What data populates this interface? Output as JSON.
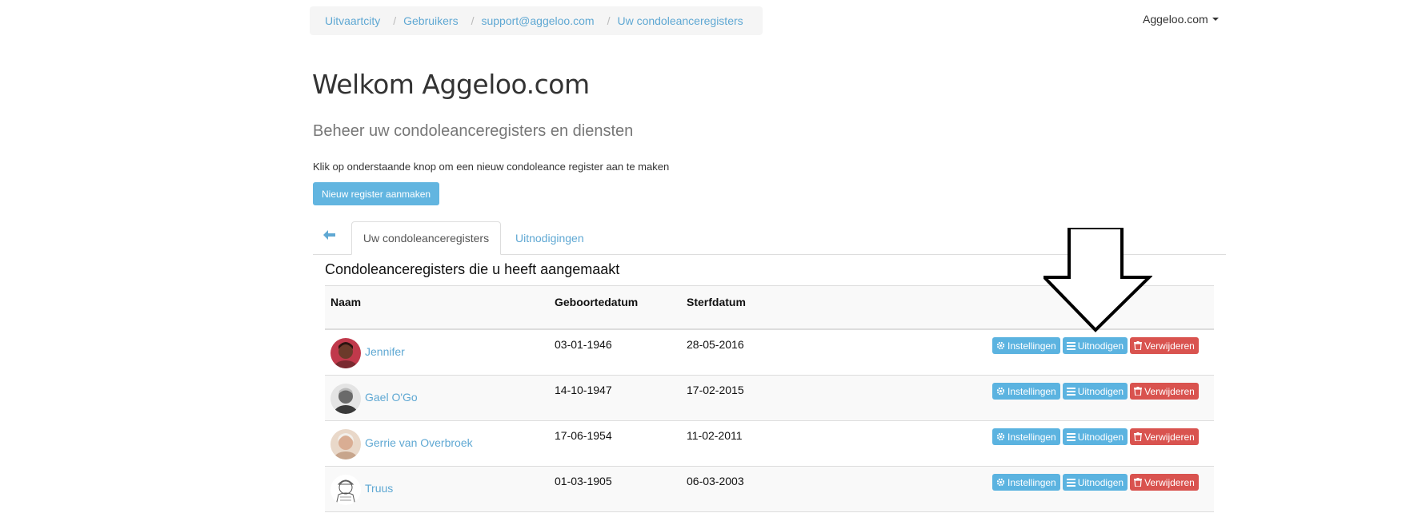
{
  "breadcrumb": [
    "Uitvaartcity",
    "Gebruikers",
    "support@aggeloo.com",
    "Uw condoleanceregisters"
  ],
  "user_menu": "Aggeloo.com",
  "title": "Welkom Aggeloo.com",
  "subtitle": "Beheer uw condoleanceregisters en diensten",
  "intro": "Klik op onderstaande knop om een nieuw condoleance register aan te maken",
  "new_button": "Nieuw register aanmaken",
  "tabs": {
    "back_icon": "arrow-left-icon",
    "active": "Uw condoleanceregisters",
    "other": "Uitnodigingen"
  },
  "section_title": "Condoleanceregisters die u heeft aangemaakt",
  "table": {
    "headers": [
      "Naam",
      "Geboortedatum",
      "Sterfdatum"
    ],
    "rows": [
      {
        "name": "Jennifer",
        "birth": "03-01-1946",
        "death": "28-05-2016"
      },
      {
        "name": "Gael O'Go",
        "birth": "14-10-1947",
        "death": "17-02-2015"
      },
      {
        "name": "Gerrie van Overbroek",
        "birth": "17-06-1954",
        "death": "11-02-2011"
      },
      {
        "name": "Truus",
        "birth": "01-03-1905",
        "death": "06-03-2003"
      }
    ],
    "actions": {
      "settings": "Instellingen",
      "invite": "Uitnodigen",
      "delete": "Verwijderen"
    }
  },
  "colors": {
    "link": "#5fa8d3",
    "info": "#5bb3e0",
    "danger": "#d9534f"
  }
}
